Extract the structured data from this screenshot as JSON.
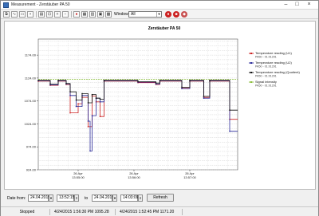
{
  "window": {
    "title": "Measurement - Zerstäuber PA 50",
    "minimize_glyph": "–",
    "maximize_glyph": "□",
    "close_glyph": "×"
  },
  "toolbar": {
    "window_label": "Window",
    "window_select_value": "All",
    "buttons": [
      "copy-icon",
      "chart-icon",
      "open-icon",
      "save-icon",
      "print-icon",
      "fit-icon",
      "zoom-in-icon",
      "zoom-out-icon",
      "grid-icon",
      "table-icon",
      "stop-icon",
      "export-icon",
      "settings-icon",
      "help-icon",
      "pin-icon",
      "info-icon"
    ],
    "accent_red": "#cc2222"
  },
  "chart_data": {
    "type": "line",
    "title": "Zerstäuber PA 50",
    "y_ticks": [
      "924.00",
      "974.00",
      "1024.00",
      "1074.00",
      "1124.00",
      "1174.00"
    ],
    "ylim": [
      924,
      1209
    ],
    "x_ticks": [
      "26 Apr\n13:55:00",
      "26 Apr\n13:56:00",
      "26 Apr\n13:57:00"
    ],
    "grid": true,
    "legend_position": "right",
    "legend": [
      {
        "name": "Temperature reading (U1)",
        "sub": "PA50 - 01:01291",
        "color": "#cc2222"
      },
      {
        "name": "Temperature reading (U2)",
        "sub": "PA50 - 01:01291",
        "color": "#2a2a99"
      },
      {
        "name": "Temperature reading (Quotient)",
        "sub": "PA50 - 01:01291",
        "color": "#111111"
      },
      {
        "name": "Signal intensity",
        "sub": "PA50 - 01:01291",
        "color": "#8abe3a"
      }
    ],
    "series": [
      {
        "name": "Temperature reading (U1)",
        "color": "#cc2222",
        "points": [
          [
            0,
            1117
          ],
          [
            0.06,
            1117
          ],
          [
            0.06,
            1108
          ],
          [
            0.1,
            1108
          ],
          [
            0.1,
            1117
          ],
          [
            0.14,
            1117
          ],
          [
            0.14,
            1110
          ],
          [
            0.16,
            1110
          ],
          [
            0.16,
            1048
          ],
          [
            0.2,
            1048
          ],
          [
            0.2,
            1068
          ],
          [
            0.22,
            1068
          ],
          [
            0.22,
            1082
          ],
          [
            0.25,
            1082
          ],
          [
            0.25,
            1018
          ],
          [
            0.27,
            1018
          ],
          [
            0.27,
            1085
          ],
          [
            0.29,
            1085
          ],
          [
            0.29,
            1072
          ],
          [
            0.31,
            1072
          ],
          [
            0.31,
            1040
          ],
          [
            0.33,
            1040
          ],
          [
            0.33,
            1117
          ],
          [
            0.5,
            1117
          ],
          [
            0.5,
            1114
          ],
          [
            0.59,
            1114
          ],
          [
            0.59,
            1110
          ],
          [
            0.61,
            1110
          ],
          [
            0.61,
            1117
          ],
          [
            0.72,
            1117
          ],
          [
            0.72,
            1102
          ],
          [
            0.76,
            1102
          ],
          [
            0.76,
            1117
          ],
          [
            0.83,
            1117
          ],
          [
            0.83,
            1082
          ],
          [
            0.86,
            1082
          ],
          [
            0.86,
            1117
          ],
          [
            0.96,
            1117
          ],
          [
            0.96,
            1034
          ],
          [
            1.0,
            1034
          ]
        ]
      },
      {
        "name": "Temperature reading (U2)",
        "color": "#2a2a99",
        "points": [
          [
            0,
            1118
          ],
          [
            0.06,
            1118
          ],
          [
            0.06,
            1109
          ],
          [
            0.1,
            1109
          ],
          [
            0.1,
            1118
          ],
          [
            0.14,
            1118
          ],
          [
            0.14,
            1111
          ],
          [
            0.16,
            1111
          ],
          [
            0.16,
            1086
          ],
          [
            0.19,
            1086
          ],
          [
            0.19,
            1062
          ],
          [
            0.22,
            1062
          ],
          [
            0.22,
            1086
          ],
          [
            0.25,
            1086
          ],
          [
            0.25,
            1030
          ],
          [
            0.26,
            1030
          ],
          [
            0.26,
            965
          ],
          [
            0.27,
            965
          ],
          [
            0.27,
            1042
          ],
          [
            0.29,
            1042
          ],
          [
            0.29,
            1080
          ],
          [
            0.31,
            1080
          ],
          [
            0.31,
            1072
          ],
          [
            0.33,
            1072
          ],
          [
            0.33,
            1118
          ],
          [
            0.5,
            1118
          ],
          [
            0.5,
            1115
          ],
          [
            0.59,
            1115
          ],
          [
            0.59,
            1111
          ],
          [
            0.61,
            1111
          ],
          [
            0.61,
            1118
          ],
          [
            0.72,
            1118
          ],
          [
            0.72,
            1101
          ],
          [
            0.76,
            1101
          ],
          [
            0.76,
            1118
          ],
          [
            0.83,
            1118
          ],
          [
            0.83,
            1080
          ],
          [
            0.86,
            1080
          ],
          [
            0.86,
            1118
          ],
          [
            0.96,
            1118
          ],
          [
            0.96,
            1008
          ],
          [
            1.0,
            1008
          ]
        ]
      },
      {
        "name": "Temperature reading (Quotient)",
        "color": "#111111",
        "points": [
          [
            0,
            1119
          ],
          [
            0.06,
            1119
          ],
          [
            0.06,
            1111
          ],
          [
            0.1,
            1111
          ],
          [
            0.1,
            1119
          ],
          [
            0.14,
            1119
          ],
          [
            0.14,
            1112
          ],
          [
            0.16,
            1112
          ],
          [
            0.16,
            1094
          ],
          [
            0.19,
            1094
          ],
          [
            0.19,
            1076
          ],
          [
            0.22,
            1076
          ],
          [
            0.22,
            1090
          ],
          [
            0.25,
            1090
          ],
          [
            0.25,
            1070
          ],
          [
            0.27,
            1070
          ],
          [
            0.27,
            1088
          ],
          [
            0.29,
            1088
          ],
          [
            0.29,
            1080
          ],
          [
            0.31,
            1080
          ],
          [
            0.31,
            1078
          ],
          [
            0.33,
            1078
          ],
          [
            0.33,
            1119
          ],
          [
            0.5,
            1119
          ],
          [
            0.5,
            1116
          ],
          [
            0.59,
            1116
          ],
          [
            0.59,
            1113
          ],
          [
            0.61,
            1113
          ],
          [
            0.61,
            1119
          ],
          [
            0.72,
            1119
          ],
          [
            0.72,
            1104
          ],
          [
            0.76,
            1104
          ],
          [
            0.76,
            1119
          ],
          [
            0.83,
            1119
          ],
          [
            0.83,
            1084
          ],
          [
            0.86,
            1084
          ],
          [
            0.86,
            1119
          ],
          [
            0.96,
            1119
          ],
          [
            0.96,
            1054
          ],
          [
            1.0,
            1054
          ]
        ]
      },
      {
        "name": "Signal intensity",
        "color": "#8abe3a",
        "points": [
          [
            0,
            1121
          ],
          [
            1.0,
            1121
          ]
        ]
      }
    ]
  },
  "bottom": {
    "date_from_label": "Date from:",
    "date_from": "24.04.2015",
    "time_from": "13:52:15",
    "to_label": "to",
    "date_to": "24.04.2015",
    "time_to": "14:03:09",
    "refresh_label": "Refresh"
  },
  "status": {
    "state": "Stopped",
    "cell2": "4/24/2015 1:56:30 PM 1095.28",
    "cell3": "4/24/2015 1:52:45 PM 1171.20"
  }
}
